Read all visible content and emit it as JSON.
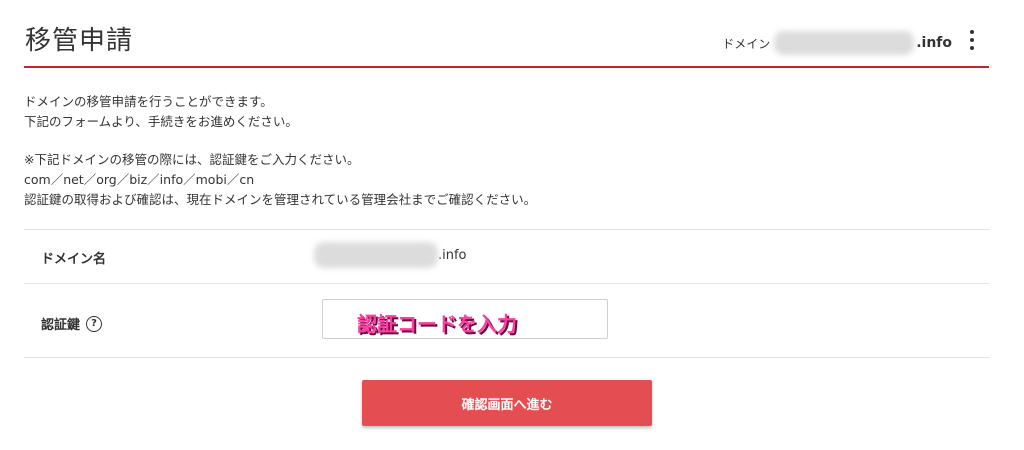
{
  "header": {
    "title": "移管申請",
    "domain_label": "ドメイン",
    "domain_suffix": ".info",
    "more_icon": "more-vertical-icon"
  },
  "intro": {
    "line1": "ドメインの移管申請を行うことができます。",
    "line2": "下記のフォームより、手続きをお進めください。"
  },
  "notes": {
    "line1": "※下記ドメインの移管の際には、認証鍵をご入力ください。",
    "line2": "com／net／org／biz／info／mobi／cn",
    "line3": "認証鍵の取得および確認は、現在ドメインを管理されている管理会社までご確認ください。"
  },
  "form": {
    "domain_name_label": "ドメイン名",
    "domain_value_suffix": ".info",
    "auth_key_label": "認証鍵",
    "help_icon": "?",
    "auth_key_value": "認証コードを入力"
  },
  "submit_label": "確認画面へ進む",
  "colors": {
    "accent": "#c0262d",
    "button": "#e44d52",
    "annotation": "#ff3da0"
  }
}
